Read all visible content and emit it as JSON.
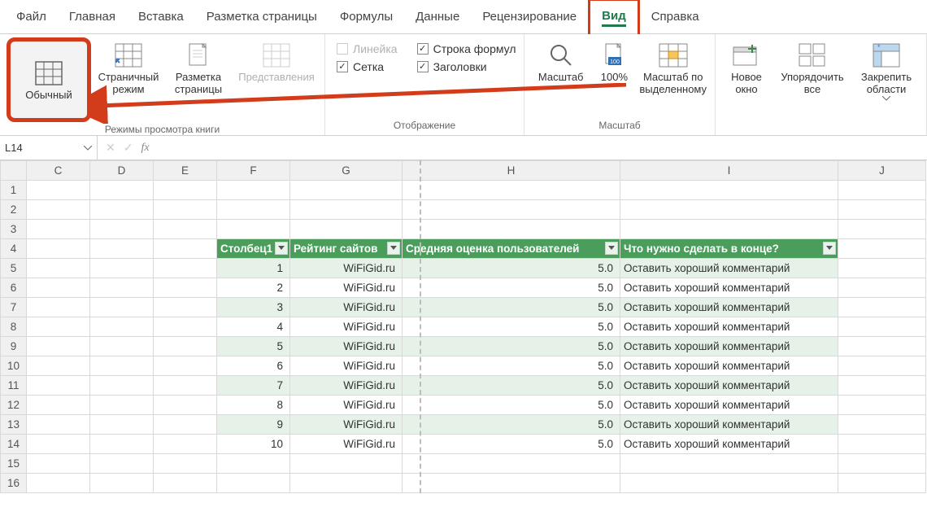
{
  "tabs": {
    "items": [
      "Файл",
      "Главная",
      "Вставка",
      "Разметка страницы",
      "Формулы",
      "Данные",
      "Рецензирование",
      "Вид",
      "Справка"
    ],
    "active": "Вид"
  },
  "ribbon": {
    "group_views": {
      "normal": "Обычный",
      "page_break": "Страничный режим",
      "page_layout": "Разметка страницы",
      "custom_views": "Представления",
      "title": "Режимы просмотра книги"
    },
    "group_show": {
      "ruler": "Линейка",
      "formula_bar": "Строка формул",
      "gridlines": "Сетка",
      "headings": "Заголовки",
      "title": "Отображение"
    },
    "group_zoom": {
      "zoom": "Масштаб",
      "zoom100": "100%",
      "zoom_selection": "Масштаб по выделенному",
      "title": "Масштаб"
    },
    "group_window": {
      "new_window": "Новое окно",
      "arrange": "Упорядочить все",
      "freeze": "Закрепить области"
    }
  },
  "formula_bar": {
    "name_box": "L14",
    "input": ""
  },
  "columns": [
    "C",
    "D",
    "E",
    "F",
    "G",
    "H",
    "I",
    "J"
  ],
  "table": {
    "headers": [
      "Столбец1",
      "Рейтинг сайтов",
      "Средняя оценка пользователей",
      "Что нужно сделать в конце?"
    ],
    "rows": [
      {
        "n": 1,
        "site": "WiFiGid.ru",
        "score": "5.0",
        "action": "Оставить хороший комментарий"
      },
      {
        "n": 2,
        "site": "WiFiGid.ru",
        "score": "5.0",
        "action": "Оставить хороший комментарий"
      },
      {
        "n": 3,
        "site": "WiFiGid.ru",
        "score": "5.0",
        "action": "Оставить хороший комментарий"
      },
      {
        "n": 4,
        "site": "WiFiGid.ru",
        "score": "5.0",
        "action": "Оставить хороший комментарий"
      },
      {
        "n": 5,
        "site": "WiFiGid.ru",
        "score": "5.0",
        "action": "Оставить хороший комментарий"
      },
      {
        "n": 6,
        "site": "WiFiGid.ru",
        "score": "5.0",
        "action": "Оставить хороший комментарий"
      },
      {
        "n": 7,
        "site": "WiFiGid.ru",
        "score": "5.0",
        "action": "Оставить хороший комментарий"
      },
      {
        "n": 8,
        "site": "WiFiGid.ru",
        "score": "5.0",
        "action": "Оставить хороший комментарий"
      },
      {
        "n": 9,
        "site": "WiFiGid.ru",
        "score": "5.0",
        "action": "Оставить хороший комментарий"
      },
      {
        "n": 10,
        "site": "WiFiGid.ru",
        "score": "5.0",
        "action": "Оставить хороший комментарий"
      }
    ]
  },
  "row_numbers": [
    1,
    2,
    3,
    4,
    5,
    6,
    7,
    8,
    9,
    10,
    11,
    12,
    13,
    14,
    15,
    16
  ]
}
